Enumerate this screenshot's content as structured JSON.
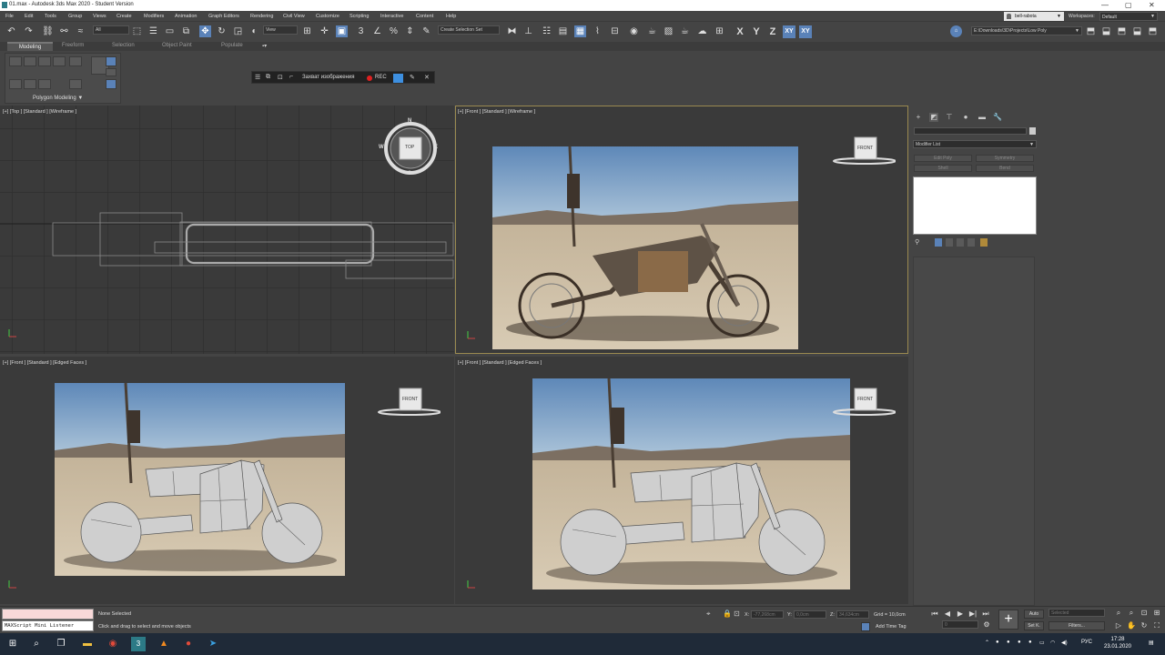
{
  "window": {
    "title": "01.max - Autodesk 3ds Max 2020 - Student Version",
    "minimize": "—",
    "maximize": "▢",
    "close": "✕"
  },
  "menu": {
    "items": [
      "File",
      "Edit",
      "Tools",
      "Group",
      "Views",
      "Create",
      "Modifiers",
      "Animation",
      "Graph Editors",
      "Rendering",
      "Civil View",
      "Customize",
      "Scripting",
      "Interactive",
      "Content",
      "Help"
    ],
    "user": "bell-rabota",
    "workspaces_label": "Workspaces:",
    "workspace_value": "Default"
  },
  "toolbar": {
    "selection_filter": "All",
    "ref_coord": "View",
    "named_selection": "Create Selection Set",
    "axis_x": "X",
    "axis_y": "Y",
    "axis_z": "Z",
    "axis_xy": "XY",
    "axis_xy2": "XY",
    "project_path": "E:\\Downloads\\3D\\Projects\\Low Poly"
  },
  "ribbon": {
    "tabs": [
      "Modeling",
      "Freeform",
      "Selection",
      "Object Paint",
      "Populate"
    ],
    "active_tab": "Modeling",
    "panel_label": "Polygon Modeling"
  },
  "capture": {
    "label": "Захват изображения",
    "rec": "REC"
  },
  "viewports": [
    {
      "label": "[+] [Top ] [Standard ] [Wireframe ]",
      "cube": "TOP",
      "compass": {
        "n": "N",
        "s": "S",
        "e": "E",
        "w": "W"
      }
    },
    {
      "label": "[+] [Front ] [Standard ] [Wireframe ]",
      "cube": "FRONT"
    },
    {
      "label": "[+] [Front ] [Standard ] [Edged Faces ]",
      "cube": "FRONT"
    },
    {
      "label": "[+] [Front ] [Standard ] [Edged Faces ]",
      "cube": "FRONT"
    }
  ],
  "command_panel": {
    "modifier_list": "Modifier List",
    "buttons": [
      "Edit Poly",
      "Symmetry",
      "Shell",
      "Bend"
    ]
  },
  "status": {
    "maxscript": "MAXScript Mini Listener",
    "selection": "None Selected",
    "prompt": "Click and drag to select and move objects",
    "x_label": "X:",
    "x_value": "-77,268cm",
    "y_label": "Y:",
    "y_value": "0,0cm",
    "z_label": "Z:",
    "z_value": "34,634cm",
    "grid": "Grid = 10,0cm",
    "add_time_tag": "Add Time Tag",
    "auto": "Auto",
    "setk": "Set K.",
    "key_mode": "Selected",
    "filters": "Filters...",
    "frame": "0"
  },
  "taskbar": {
    "lang": "РУС",
    "time": "17:28",
    "date": "23.01.2020"
  },
  "colors": {
    "accent": "#5a82b8",
    "viewport_bg": "#3a3a3a",
    "active_border": "#9a8a50",
    "taskbar": "#1f2a38"
  }
}
